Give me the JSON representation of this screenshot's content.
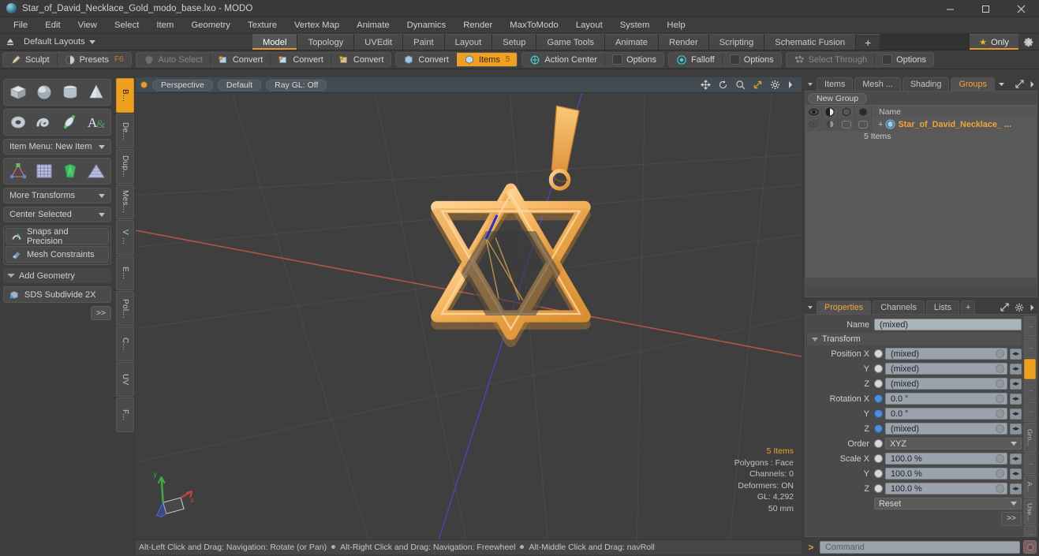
{
  "window": {
    "title": "Star_of_David_Necklace_Gold_modo_base.lxo - MODO",
    "logo_icon": "modo-logo-icon",
    "minimize": "minimize-icon",
    "maximize": "maximize-icon",
    "close": "close-icon"
  },
  "menubar": {
    "items": [
      "File",
      "Edit",
      "View",
      "Select",
      "Item",
      "Geometry",
      "Texture",
      "Vertex Map",
      "Animate",
      "Dynamics",
      "Render",
      "MaxToModo",
      "Layout",
      "System",
      "Help"
    ]
  },
  "layoutbar": {
    "up_icon": "up-arrow-icon",
    "layouts_label": "Default Layouts",
    "tabs": [
      "Model",
      "Topology",
      "UVEdit",
      "Paint",
      "Layout",
      "Setup",
      "Game Tools",
      "Animate",
      "Render",
      "Scripting",
      "Schematic Fusion"
    ],
    "active_tab": "Model",
    "add_tab": "+",
    "only_label": "Only",
    "only_icon": "star-icon",
    "settings_icon": "gear-icon"
  },
  "modebar": {
    "groups": [
      {
        "buttons": [
          {
            "label": "Sculpt",
            "icon": "brush-icon",
            "state": "normal"
          },
          {
            "label": "Presets",
            "icon": "sphere-half-icon",
            "state": "normal",
            "badge": "F6"
          }
        ]
      },
      {
        "buttons": [
          {
            "label": "Auto Select",
            "icon": "shield-icon",
            "state": "dim"
          },
          {
            "label": "Convert",
            "icon": "vertex-icon",
            "state": "normal"
          },
          {
            "label": "Convert",
            "icon": "edge-icon",
            "state": "normal"
          },
          {
            "label": "Convert",
            "icon": "polygon-icon",
            "state": "normal"
          }
        ]
      },
      {
        "buttons": [
          {
            "label": "Convert",
            "icon": "material-icon",
            "state": "normal"
          },
          {
            "label": "Items",
            "icon": "items-icon",
            "state": "active",
            "badge": "5"
          }
        ]
      },
      {
        "buttons": [
          {
            "label": "Action Center",
            "icon": "action-center-icon",
            "state": "normal"
          },
          {
            "label": "Options",
            "icon": "checkbox-icon",
            "state": "normal"
          }
        ]
      },
      {
        "buttons": [
          {
            "label": "Falloff",
            "icon": "falloff-icon",
            "state": "normal"
          },
          {
            "label": "Options",
            "icon": "checkbox-icon",
            "state": "normal"
          }
        ]
      },
      {
        "buttons": [
          {
            "label": "Select Through",
            "icon": "select-through-icon",
            "state": "dim"
          },
          {
            "label": "Options",
            "icon": "checkbox-icon",
            "state": "normal"
          }
        ]
      }
    ]
  },
  "left_panel": {
    "primitives_row1": [
      "cube-icon",
      "sphere-icon",
      "cylinder-icon",
      "cone-icon"
    ],
    "primitives_row2": [
      "torus-icon",
      "spiral-icon",
      "teardrop-icon",
      "text-icon"
    ],
    "item_menu": "Item Menu: New Item",
    "tools_row": [
      "joint-icon",
      "grid-icon",
      "gem-icon",
      "terrain-icon"
    ],
    "more_transforms": "More Transforms",
    "center_selected": "Center Selected",
    "snaps": {
      "label": "Snaps and Precision",
      "icon": "magnet-icon"
    },
    "mesh_constraints": {
      "label": "Mesh Constraints",
      "icon": "constraint-icon"
    },
    "add_geometry": "Add Geometry",
    "sds_subdivide": {
      "label": "SDS Subdivide 2X",
      "icon": "subdivide-icon"
    },
    "expand_button": ">>",
    "vertical_tabs": [
      "B...",
      "De...",
      "Dup...",
      "Mes...",
      "V ...",
      "E...",
      "Pol...",
      "C...",
      "UV",
      "F..."
    ],
    "vertical_active": "B..."
  },
  "viewport": {
    "view_mode": "Perspective",
    "shading": "Default",
    "raygl": "Ray GL: Off",
    "header_icons": [
      "move-icon",
      "rotate-icon",
      "zoom-icon",
      "fit-icon",
      "gear-icon",
      "chevron-right-icon"
    ],
    "stats": {
      "items": "5 Items",
      "polygons": "Polygons : Face",
      "channels": "Channels: 0",
      "deformers": "Deformers: ON",
      "gl": "GL: 4,292",
      "scale": "50 mm"
    },
    "axis_gizmo": {
      "x": "x",
      "y": "y",
      "z": "z"
    },
    "model_color": "#f0ab4a"
  },
  "statusbar": {
    "hints": [
      "Alt-Left Click and Drag: Navigation: Rotate (or Pan)",
      "Alt-Right Click and Drag: Navigation: Freewheel",
      "Alt-Middle Click and Drag: navRoll"
    ]
  },
  "items_panel": {
    "tabs": [
      "Items",
      "Mesh ...",
      "Shading",
      "Groups"
    ],
    "active_tab": "Groups",
    "dropdown_icon": "chevron-down-icon",
    "expand_icon": "expand-icon",
    "more_icon": "chevron-right-icon",
    "new_group_button": "New Group",
    "column_icons": [
      "eye-icon",
      "shade-icon",
      "render-icon",
      "select-icon"
    ],
    "name_column": "Name",
    "rows": [
      {
        "name": "Star_of_David_Necklace_ ...",
        "subtitle": "5 Items",
        "icon": "group-icon",
        "expander": "+"
      }
    ]
  },
  "properties_panel": {
    "tabs": [
      "Properties",
      "Channels",
      "Lists"
    ],
    "active_tab": "Properties",
    "add_tab": "+",
    "expand_icon": "expand-icon",
    "gear_icon": "gear-icon",
    "more_icon": "chevron-right-icon",
    "name_label": "Name",
    "name_value": "(mixed)",
    "transform_header": "Transform",
    "fields": [
      {
        "label": "Position X",
        "value": "(mixed)",
        "radio": "gray"
      },
      {
        "label": "Y",
        "value": "(mixed)",
        "radio": "gray"
      },
      {
        "label": "Z",
        "value": "(mixed)",
        "radio": "gray"
      },
      {
        "label": "Rotation X",
        "value": "0.0 °",
        "radio": "blue"
      },
      {
        "label": "Y",
        "value": "0.0 °",
        "radio": "blue"
      },
      {
        "label": "Z",
        "value": "(mixed)",
        "radio": "blue"
      }
    ],
    "order_label": "Order",
    "order_value": "XYZ",
    "scale_fields": [
      {
        "label": "Scale X",
        "value": "100.0 %",
        "radio": "gray"
      },
      {
        "label": "Y",
        "value": "100.0 %",
        "radio": "gray"
      },
      {
        "label": "Z",
        "value": "100.0 %",
        "radio": "gray"
      }
    ],
    "reset_label": "Reset",
    "expand_button": ">>",
    "vertical_tabs": [
      "",
      "",
      "",
      "",
      "",
      "Gro...",
      "",
      "A...",
      "Use...",
      ""
    ],
    "vertical_active_index": 2
  },
  "command_bar": {
    "prompt": ">",
    "placeholder": "Command",
    "record_icon": "record-icon"
  }
}
